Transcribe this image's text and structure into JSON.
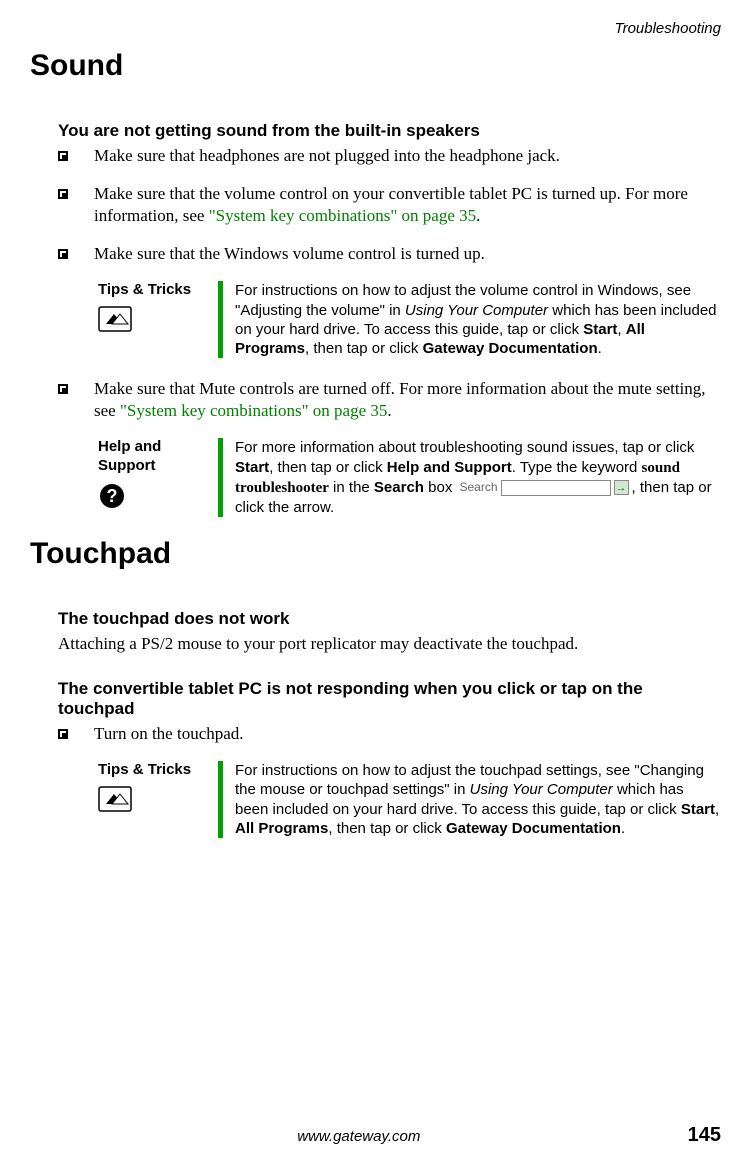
{
  "header": {
    "breadcrumb": "Troubleshooting"
  },
  "sections": {
    "sound": {
      "title": "Sound",
      "problem1": {
        "heading": "You are not getting sound from the built-in speakers",
        "bullets": [
          {
            "text": "Make sure that headphones are not plugged into the headphone jack."
          },
          {
            "pre": "Make sure that the volume control on your convertible tablet PC is turned up. For more information, see ",
            "link": "\"System key combinations\" on page 35",
            "post": "."
          },
          {
            "text": "Make sure that the Windows volume control is turned up."
          },
          {
            "pre": "Make sure that Mute controls are turned off. For more information about the mute setting, see ",
            "link": "\"System key combinations\" on page 35",
            "post": "."
          }
        ]
      },
      "tip1": {
        "label": "Tips & Tricks",
        "body_pre": "For instructions on how to adjust the volume control in Windows, see \"Adjusting the volume\" in ",
        "body_italic": "Using Your Computer",
        "body_mid": " which has been included on your hard drive. To access this guide, tap or click ",
        "start": "Start",
        "comma1": ", ",
        "allprograms": "All Programs",
        "comma2": ", then tap or click ",
        "gateway": "Gateway Documentation",
        "period": "."
      },
      "help1": {
        "label": "Help and Support",
        "body_pre": "For more information about troubleshooting sound issues, tap or click ",
        "start": "Start",
        "mid1": ", then tap or click ",
        "helpsupport": "Help and Support",
        "mid2": ". Type the keyword ",
        "keyword": "sound troubleshooter",
        "mid3": " in the ",
        "search": "Search",
        "mid4": " box ",
        "search_label": "Search",
        "tail": ", then tap or click the arrow."
      }
    },
    "touchpad": {
      "title": "Touchpad",
      "problem1": {
        "heading": "The touchpad does not work",
        "body": "Attaching a PS/2 mouse to your port replicator may deactivate the touchpad."
      },
      "problem2": {
        "heading": "The convertible tablet PC is not responding when you click or tap on the touchpad",
        "bullets": [
          {
            "text": "Turn on the touchpad."
          }
        ]
      },
      "tip1": {
        "label": "Tips & Tricks",
        "body_pre": "For instructions on how to adjust the touchpad settings, see \"Changing the mouse or touchpad settings\" in ",
        "body_italic": "Using Your Computer",
        "body_mid": " which has been included on your hard drive. To access this guide, tap or click ",
        "start": "Start",
        "comma1": ", ",
        "allprograms": "All Programs",
        "comma2": ", then tap or click ",
        "gateway": "Gateway Documentation",
        "period": "."
      }
    }
  },
  "footer": {
    "url": "www.gateway.com",
    "page": "145"
  }
}
